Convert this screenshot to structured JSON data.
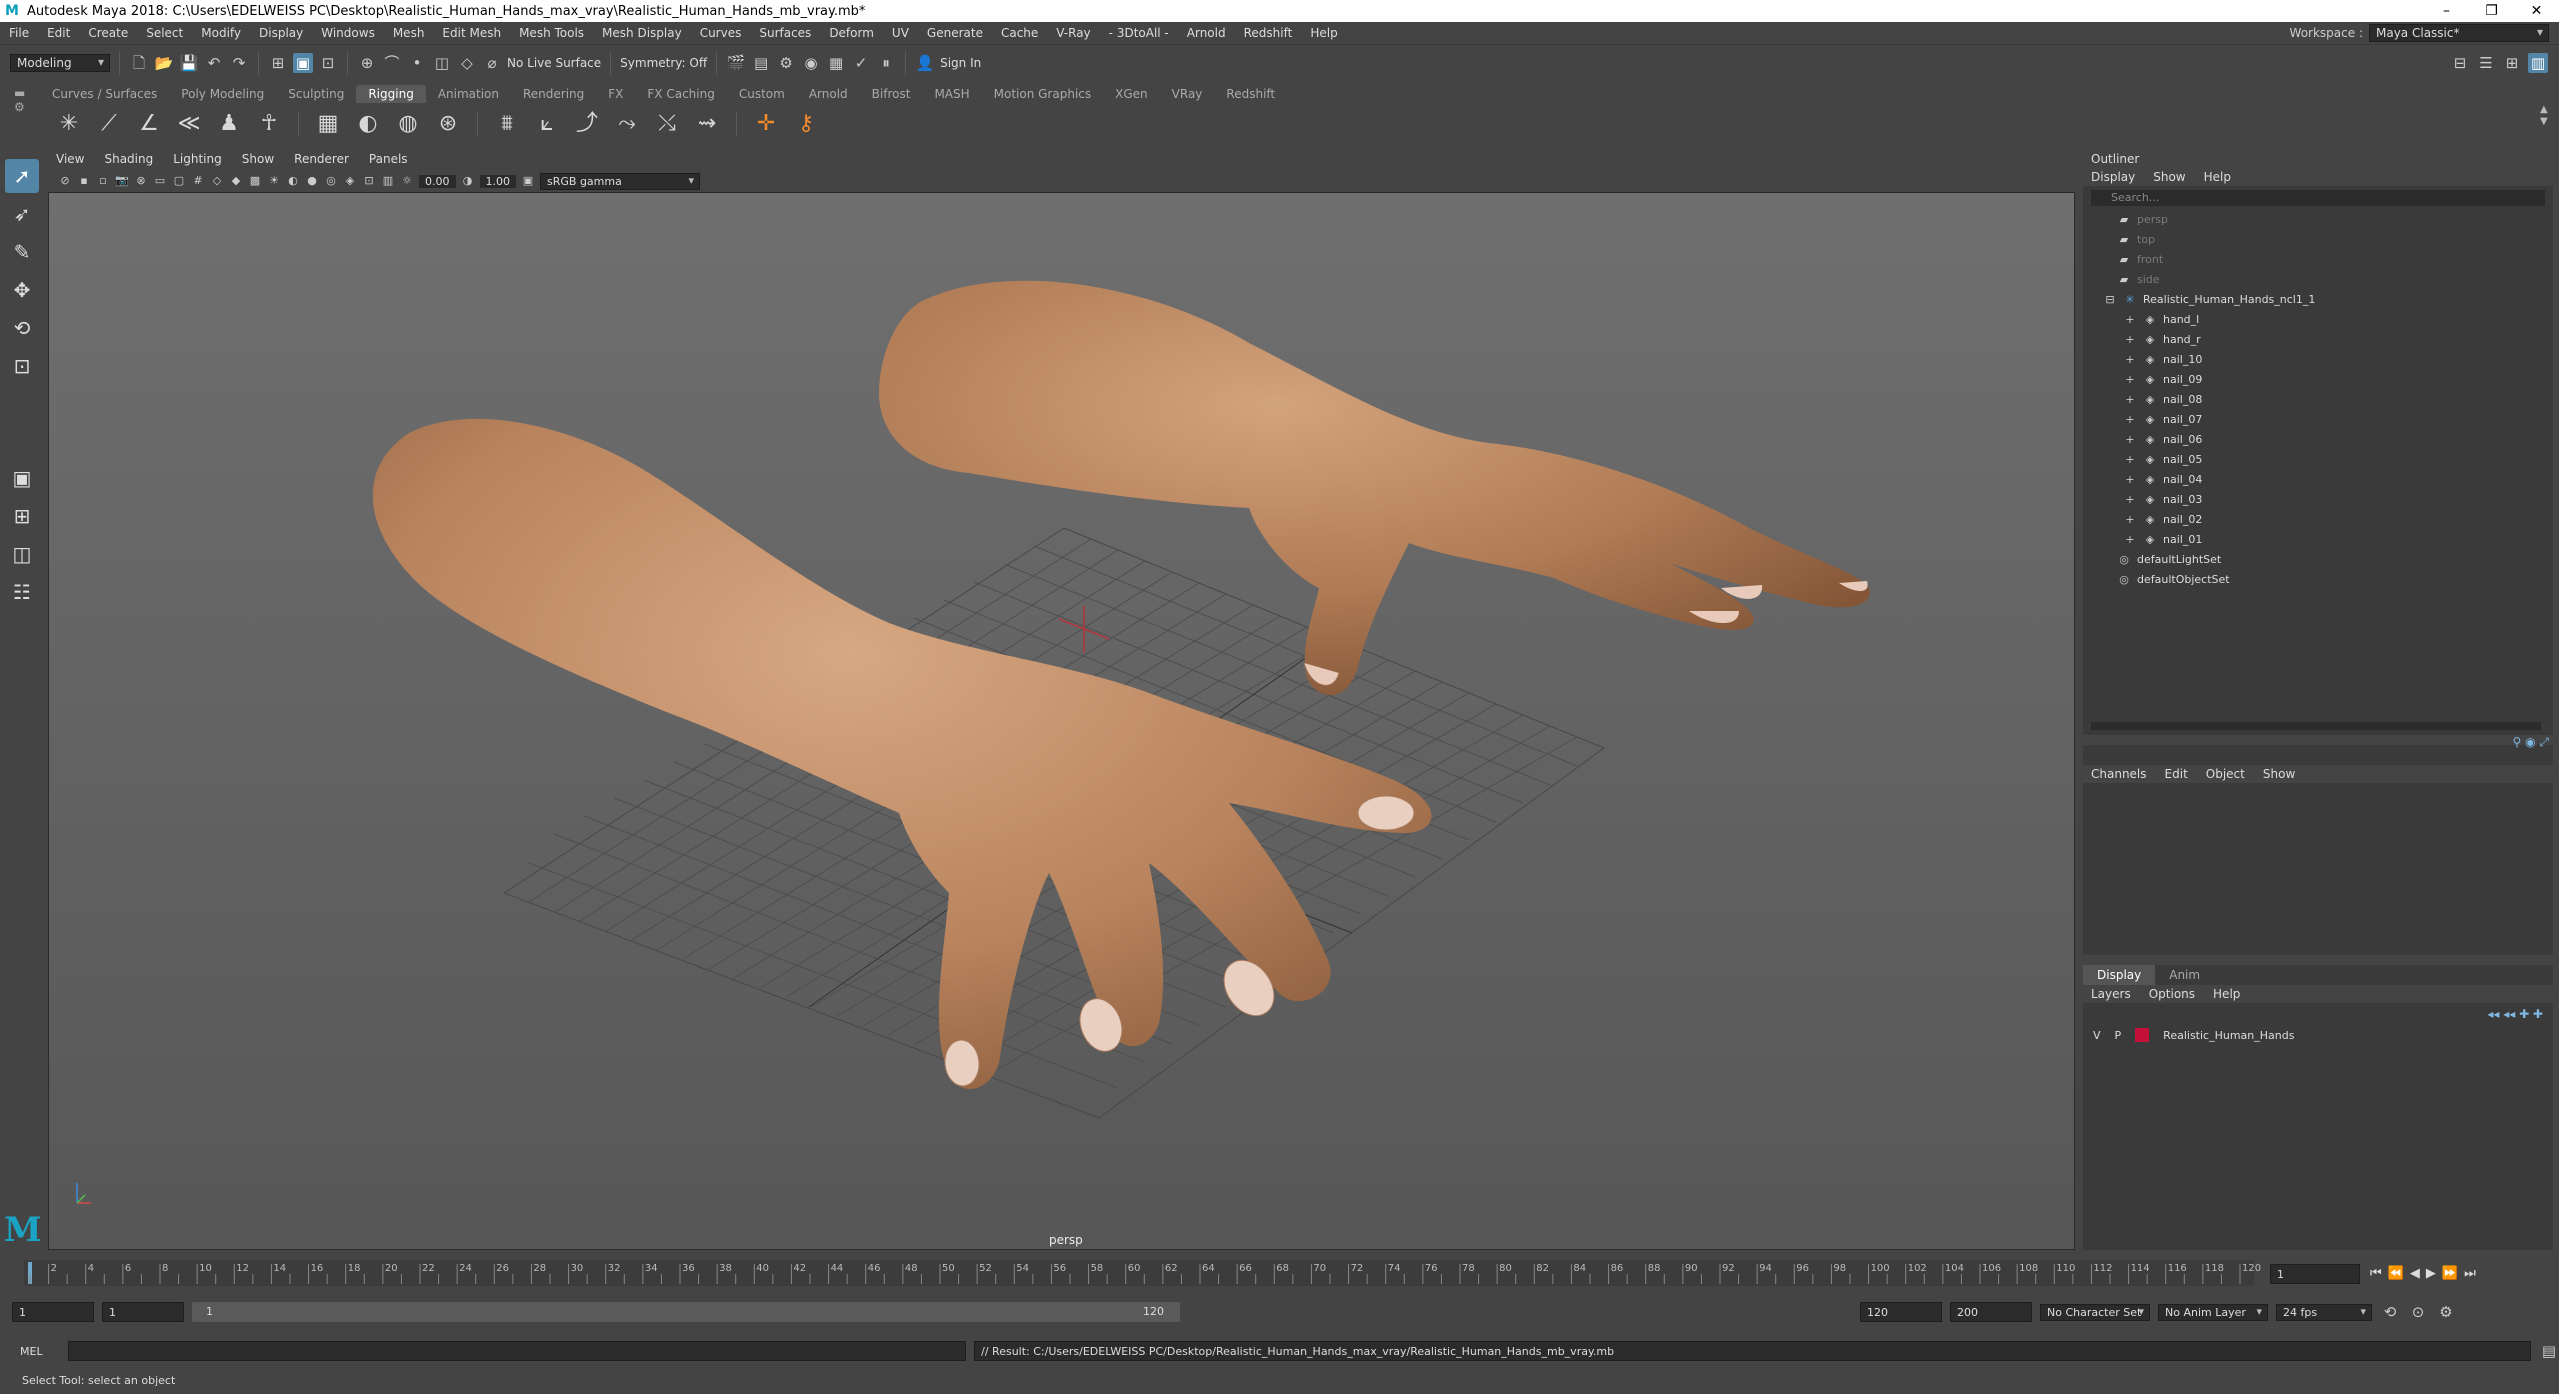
{
  "window": {
    "title": "Autodesk Maya 2018: C:\\Users\\EDELWEISS PC\\Desktop\\Realistic_Human_Hands_max_vray\\Realistic_Human_Hands_mb_vray.mb*"
  },
  "menubar": [
    "File",
    "Edit",
    "Create",
    "Select",
    "Modify",
    "Display",
    "Windows",
    "Mesh",
    "Edit Mesh",
    "Mesh Tools",
    "Mesh Display",
    "Curves",
    "Surfaces",
    "Deform",
    "UV",
    "Generate",
    "Cache",
    "V-Ray",
    "- 3DtoAll -",
    "Arnold",
    "Redshift",
    "Help"
  ],
  "workspace": {
    "label": "Workspace :",
    "value": "Maya Classic*"
  },
  "statusline": {
    "mode": "Modeling",
    "live_surface": "No Live Surface",
    "symmetry": "Symmetry: Off",
    "sign_in": "Sign In"
  },
  "shelf_tabs": [
    "Curves / Surfaces",
    "Poly Modeling",
    "Sculpting",
    "Rigging",
    "Animation",
    "Rendering",
    "FX",
    "FX Caching",
    "Custom",
    "Arnold",
    "Bifrost",
    "MASH",
    "Motion Graphics",
    "XGen",
    "VRay",
    "Redshift"
  ],
  "shelf_active": "Rigging",
  "viewport": {
    "menus": [
      "View",
      "Shading",
      "Lighting",
      "Show",
      "Renderer",
      "Panels"
    ],
    "exposure": "0.00",
    "gamma": "1.00",
    "colorspace": "sRGB gamma",
    "camera": "persp"
  },
  "outliner": {
    "title": "Outliner",
    "menus": [
      "Display",
      "Show",
      "Help"
    ],
    "search_placeholder": "Search...",
    "cameras": [
      "persp",
      "top",
      "front",
      "side"
    ],
    "group": "Realistic_Human_Hands_ncl1_1",
    "children": [
      "hand_l",
      "hand_r",
      "nail_10",
      "nail_09",
      "nail_08",
      "nail_07",
      "nail_06",
      "nail_05",
      "nail_04",
      "nail_03",
      "nail_02",
      "nail_01"
    ],
    "sets": [
      "defaultLightSet",
      "defaultObjectSet"
    ]
  },
  "channelbox": {
    "menus": [
      "Channels",
      "Edit",
      "Object",
      "Show"
    ]
  },
  "layer_editor": {
    "tabs": [
      "Display",
      "Anim"
    ],
    "menus": [
      "Layers",
      "Options",
      "Help"
    ],
    "layer": {
      "v": "V",
      "p": "P",
      "name": "Realistic_Human_Hands",
      "color": "#c5103a"
    }
  },
  "timeline": {
    "ticks": [
      2,
      4,
      6,
      8,
      10,
      12,
      14,
      16,
      18,
      20,
      22,
      24,
      26,
      28,
      30,
      32,
      34,
      36,
      38,
      40,
      42,
      44,
      46,
      48,
      50,
      52,
      54,
      56,
      58,
      60,
      62,
      64,
      66,
      68,
      70,
      72,
      74,
      76,
      78,
      80,
      82,
      84,
      86,
      88,
      90,
      92,
      94,
      96,
      98,
      100,
      102,
      104,
      106,
      108,
      110,
      112,
      114,
      116,
      118,
      120
    ],
    "current_frame": "1",
    "range_start": "1",
    "range_start2": "1",
    "slider_start": "1",
    "slider_end": "120",
    "end": "120",
    "end2": "200",
    "character_set": "No Character Set",
    "anim_layer": "No Anim Layer",
    "fps": "24 fps"
  },
  "cmdline": {
    "label": "MEL",
    "result": "// Result: C:/Users/EDELWEISS PC/Desktop/Realistic_Human_Hands_max_vray/Realistic_Human_Hands_mb_vray.mb"
  },
  "helpline": "Select Tool: select an object"
}
